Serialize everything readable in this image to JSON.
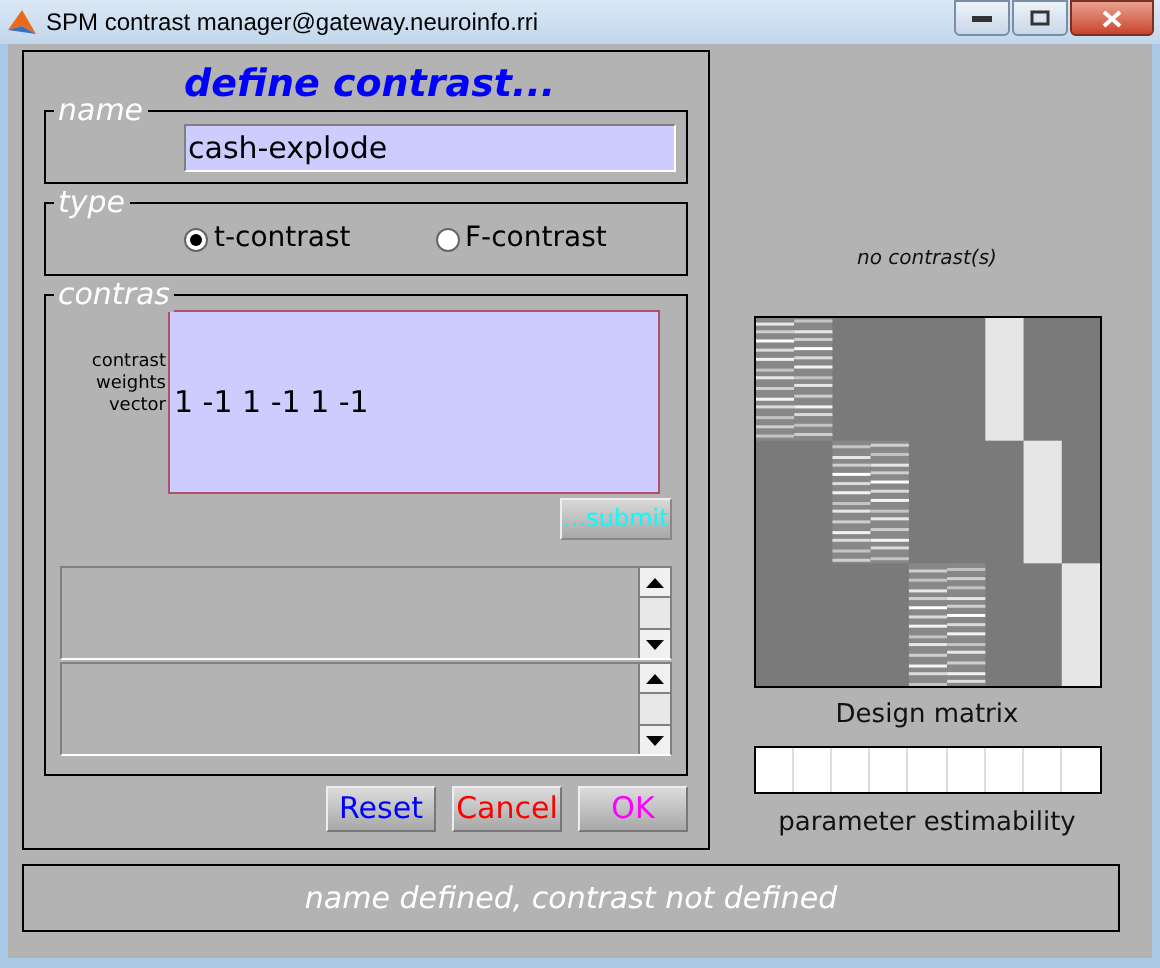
{
  "window": {
    "title": "SPM contrast manager@gateway.neuroinfo.rri"
  },
  "heading": "define contrast...",
  "name": {
    "legend": "name",
    "value": "cash-explode"
  },
  "type": {
    "legend": "type",
    "options": [
      {
        "label": "t-contrast",
        "selected": true
      },
      {
        "label": "F-contrast",
        "selected": false
      }
    ]
  },
  "contrast": {
    "legend": "contras",
    "field_label": "contrast weights vector",
    "value": "1 -1 1 -1 1 -1",
    "submit": "...submit"
  },
  "buttons": [
    {
      "label": "Reset",
      "color": "#0000ff"
    },
    {
      "label": "Cancel",
      "color": "#ff0000"
    },
    {
      "label": "OK",
      "color": "#ff00ff"
    }
  ],
  "status": "name defined, contrast not defined",
  "contrast_list": {
    "caption": "no contrast(s)"
  },
  "design_matrix": {
    "caption": "Design matrix"
  },
  "estimability": {
    "caption": "parameter estimability"
  }
}
